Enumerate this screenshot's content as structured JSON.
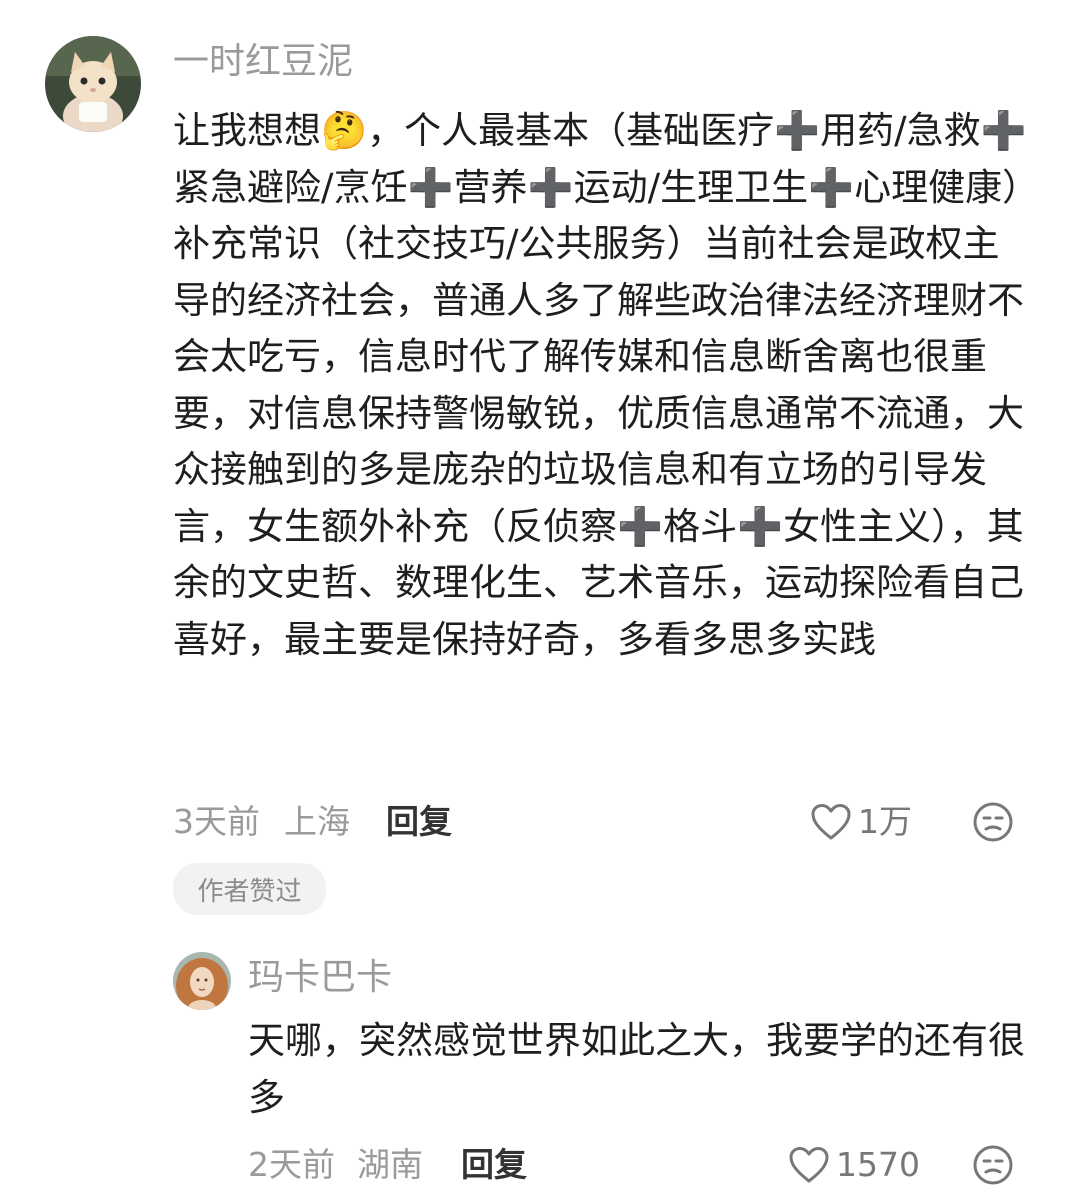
{
  "comments": [
    {
      "username": "一时红豆泥",
      "text": "让我想想🤔，个人最基本（基础医疗➕用药/急救➕紧急避险/烹饪➕营养➕运动/生理卫生➕心理健康）补充常识（社交技巧/公共服务）当前社会是政权主导的经济社会，普通人多了解些政治律法经济理财不会太吃亏，信息时代了解传媒和信息断舍离也很重要，对信息保持警惕敏锐，优质信息通常不流通，大众接触到的多是庞杂的垃圾信息和有立场的引导发言，女生额外补充（反侦察➕格斗➕女性主义），其余的文史哲、数理化生、艺术音乐，运动探险看自己喜好，最主要是保持好奇，多看多思多实践",
      "time": "3天前",
      "location": "上海",
      "reply_label": "回复",
      "likes": "1万",
      "badge": "作者赞过",
      "avatar_icon": "cat-avatar-icon"
    },
    {
      "username": "玛卡巴卡",
      "text": "天哪，突然感觉世界如此之大，我要学的还有很多",
      "time": "2天前",
      "location": "湖南",
      "reply_label": "回复",
      "likes": "1570",
      "avatar_icon": "portrait-avatar-icon"
    }
  ],
  "colors": {
    "meta_text": "#9a9a9a",
    "body_text": "#1e1e1e",
    "badge_bg": "#f2f2f2"
  }
}
